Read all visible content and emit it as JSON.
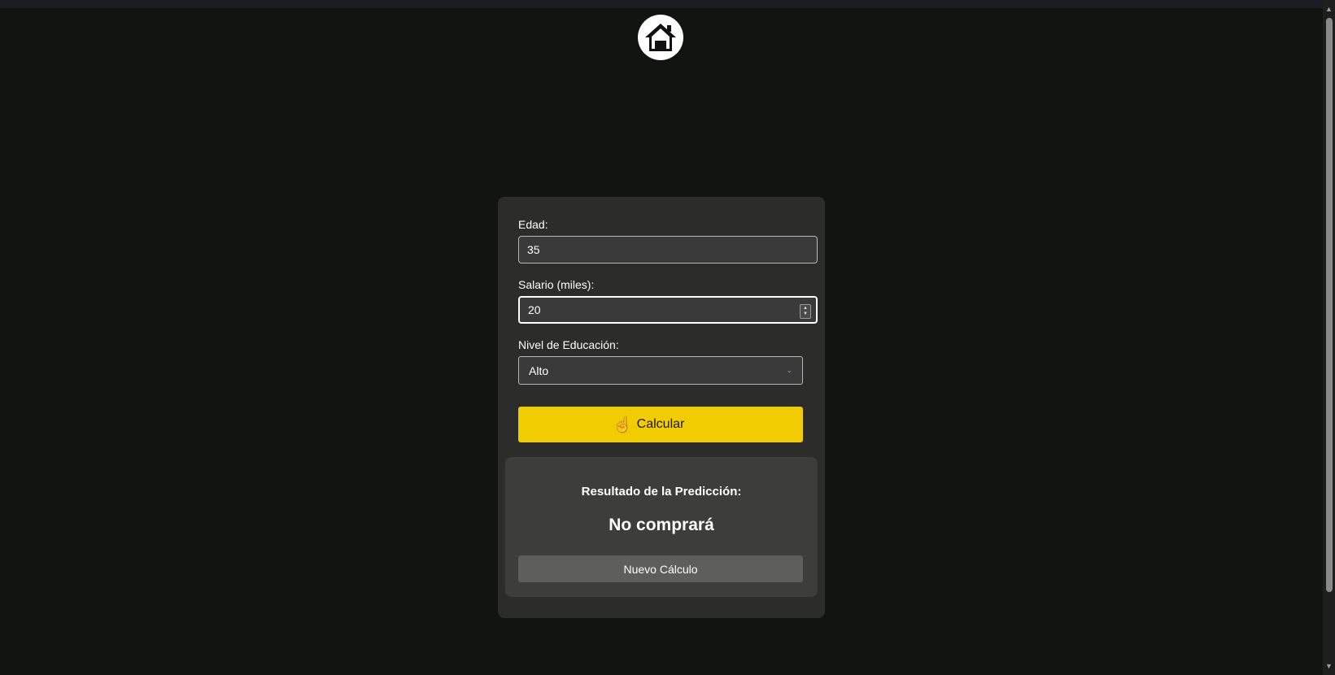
{
  "header": {
    "home_icon": "home-icon"
  },
  "form": {
    "edad": {
      "label": "Edad:",
      "value": "35"
    },
    "salario": {
      "label": "Salario (miles):",
      "value": "20"
    },
    "educacion": {
      "label": "Nivel de Educación:",
      "selected": "Alto"
    },
    "calc_button_label": "Calcular"
  },
  "result": {
    "heading": "Resultado de la Predicción:",
    "value": "No comprará",
    "new_button_label": "Nuevo Cálculo"
  },
  "colors": {
    "background": "#121412",
    "card": "#2c2c2a",
    "result_panel": "#3d3d3b",
    "accent_button": "#f0cc00",
    "secondary_button": "#5e5e5c"
  }
}
